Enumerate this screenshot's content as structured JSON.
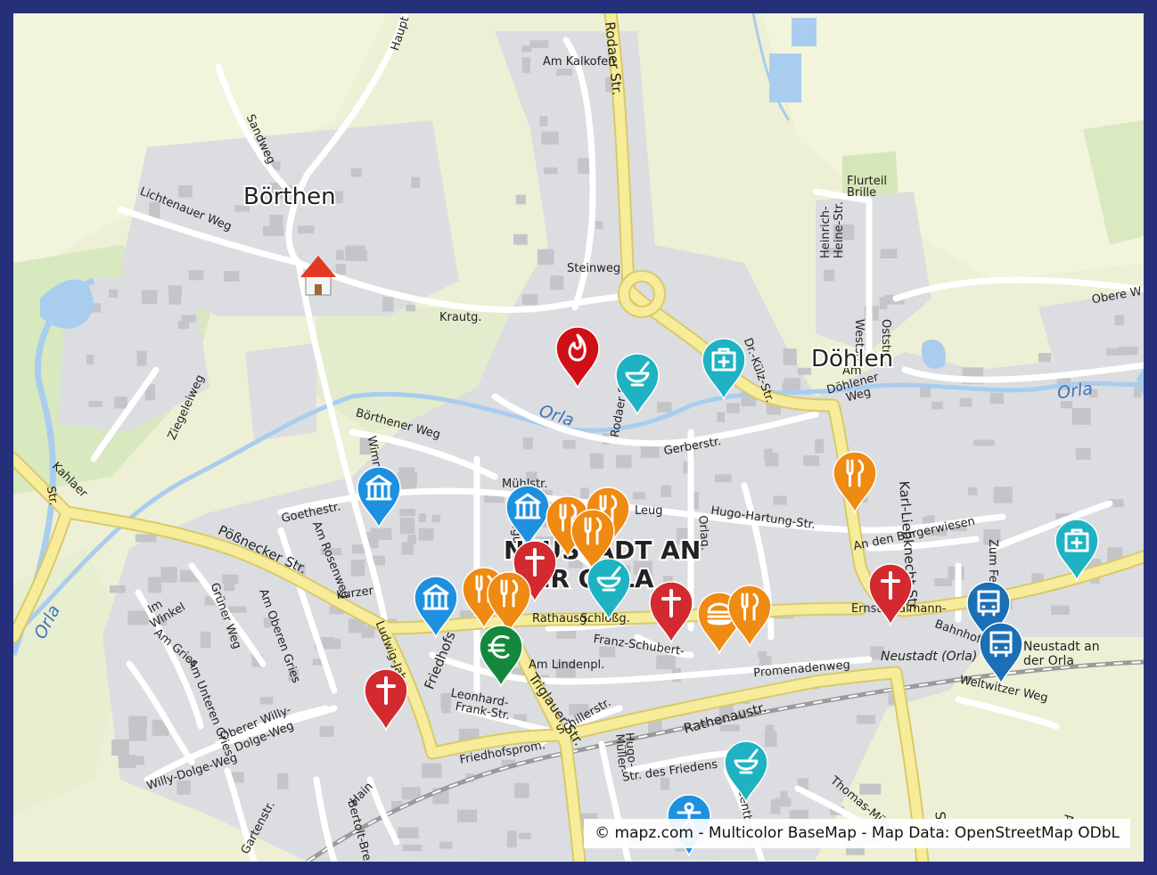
{
  "attribution": "© mapz.com - Multicolor BaseMap - Map Data: OpenStreetMap ODbL",
  "colors": {
    "frame": "#26307a",
    "land": "#e9ebd9",
    "field": "#f0f4d8",
    "forest": "#d5e6b8",
    "urban": "#dcdcdf",
    "building": "#c4c4c8",
    "water": "#a9cdef",
    "major_road": "#f6ec9a",
    "major_road_casing": "#d9c96a",
    "minor_road": "#ffffff",
    "marker_church": "#d32a30",
    "marker_food": "#ef8a12",
    "marker_pharmacy": "#1fb2c2",
    "marker_museum": "#1e90e0",
    "marker_bus": "#1a6fb5",
    "marker_bank": "#14893e",
    "marker_fire": "#d10f17"
  },
  "places": [
    {
      "text": "Börthen",
      "size": 26
    },
    {
      "text": "Döhlen",
      "size": 26
    },
    {
      "text": "NEUSTADT AN",
      "size": 28
    },
    {
      "text": "DER ORLA",
      "size": 28
    }
  ],
  "streets": [
    "Haupt",
    "Sandweg",
    "Am Kalkofen",
    "Rodaer Str.",
    "Lichtenauer Weg",
    "Steinweg",
    "Krautg.",
    "Flurteil",
    "Brille",
    "Heinrich-",
    "Heine-Str.",
    "Obere W",
    "Weststr.",
    "Oststr.",
    "Am",
    "Döhlener",
    "Weg",
    "Ziegeleiweg",
    "Börthener Weg",
    "Wimmlerstr.",
    "Gerberstr.",
    "Kahlaer",
    "Str.",
    "Goethestr.",
    "Mühlstr.",
    "Leug",
    "Hugo-Hartung-Str.",
    "An den Bürgerwiesen",
    "Zum Festpl.",
    "Am Rosenweg",
    "August-Bebel",
    "Orlag.",
    "Kurzer",
    "Rodaer Str.",
    "Pößnecker Str.",
    "Grüner Weg",
    "Am Oberen Gries",
    "Im",
    "Winkel",
    "Am Gries",
    "Am Unteren Gries",
    "Ludwig-Jahn-",
    "Friedhofs",
    "Ernst-Thälmann-",
    "Bahnhof",
    "Neustadt an",
    "der Orla",
    "Neustadt (Orla)",
    "Rathausg.",
    "Schloßg.",
    "Franz-Schubert-",
    "Am Lindenpl.",
    "Promenadenweg",
    "Weltwitzer Weg",
    "Oberer Willy-",
    "Dolge-Weg",
    "Willy-Dolge-Weg",
    "Leonhard-",
    "Frank-Str.",
    "Triglauer Str.",
    "Schillerstr.",
    "Rathenaustr.",
    "Hugo-",
    "Müller-",
    "Str. des Friedens",
    "Centbau",
    "Friedhofsprom.",
    "Gartenstr.",
    "Bertolt-Bre",
    "Hain",
    "Thomas-Münz",
    "Schl",
    "Am",
    "Karl-Liebknecht-Str.",
    "Dr.-Külz-Str."
  ],
  "water_labels": [
    "Orla",
    "Orla",
    "Orla"
  ],
  "markers": [
    {
      "type": "house",
      "icon": "house-icon"
    },
    {
      "type": "fire",
      "icon": "flame-icon"
    },
    {
      "type": "pharmacy",
      "icon": "mortar-icon"
    },
    {
      "type": "pharmacy",
      "icon": "first-aid-icon"
    },
    {
      "type": "food",
      "icon": "fork-knife-icon"
    },
    {
      "type": "museum",
      "icon": "building-columns-icon"
    },
    {
      "type": "museum",
      "icon": "building-columns-icon"
    },
    {
      "type": "food",
      "icon": "fork-knife-icon"
    },
    {
      "type": "food",
      "icon": "fork-knife-icon"
    },
    {
      "type": "food",
      "icon": "fork-knife-icon"
    },
    {
      "type": "church",
      "icon": "cross-icon"
    },
    {
      "type": "pharmacy",
      "icon": "mortar-icon"
    },
    {
      "type": "museum",
      "icon": "building-columns-icon"
    },
    {
      "type": "food",
      "icon": "fork-knife-icon"
    },
    {
      "type": "food",
      "icon": "fork-knife-icon"
    },
    {
      "type": "bank",
      "icon": "euro-icon"
    },
    {
      "type": "church",
      "icon": "cross-icon"
    },
    {
      "type": "food",
      "icon": "burger-icon"
    },
    {
      "type": "food",
      "icon": "fork-knife-icon"
    },
    {
      "type": "church",
      "icon": "cross-icon"
    },
    {
      "type": "pharmacy",
      "icon": "first-aid-icon"
    },
    {
      "type": "bus",
      "icon": "bus-icon"
    },
    {
      "type": "bus",
      "icon": "bus-icon"
    },
    {
      "type": "church",
      "icon": "cross-icon"
    },
    {
      "type": "pharmacy",
      "icon": "mortar-icon"
    },
    {
      "type": "museum",
      "icon": "person-icon"
    }
  ]
}
